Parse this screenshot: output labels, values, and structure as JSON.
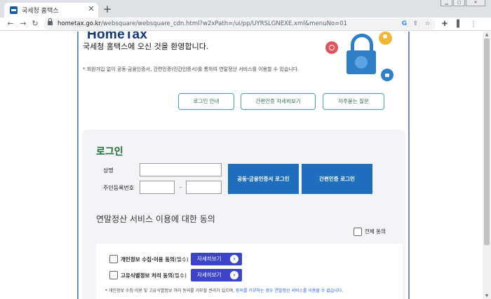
{
  "browser": {
    "tab_title": "국세청 홈택스",
    "tab_close": "✕",
    "new_tab": "+",
    "url_host": "hometax.go.kr",
    "url_path": "/websquare/websquare_cdn.html?w2xPath=/ui/pp/UYRSLGNEXE.xml&menuNo=01",
    "icons": {
      "back": "back-icon",
      "forward": "forward-icon",
      "reload": "reload-icon",
      "lock": "lock-icon",
      "google": "google-icon",
      "share": "share-icon",
      "star": "star-icon",
      "extensions": "puzzle-icon",
      "sidepanel": "sidepanel-icon",
      "menu": "menu-dots-icon"
    }
  },
  "header": {
    "logo": "HomeTax",
    "welcome": "국세청 홈택스에 오신 것을 환영합니다.",
    "notice": "* 회원가입 없이 공동·금융인증서, 간편인증(민간인증서)를 통하여 연말정산 서비스를 이용할 수 있습니다."
  },
  "links": {
    "login_guide": "로그인 안내",
    "simple_auth_detail": "간편인증 자세히보기",
    "faq": "자주묻는 질문"
  },
  "login": {
    "title": "로그인",
    "name_label": "성명",
    "rrn_label": "주민등록번호",
    "rrn_separator": "-",
    "cert_login_button": "공동·금융인증서 로그인",
    "simple_login_button": "간편인증 로그인"
  },
  "consent": {
    "title": "연말정산 서비스 이용에 대한 동의",
    "agree_all": "전체 동의",
    "items": [
      {
        "label": "개인정보 수집·이용 동의",
        "required": "(필수)",
        "button": "자세히보기"
      },
      {
        "label": "고유식별정보 처리 동의",
        "required": "(필수)",
        "button": "자세히보기"
      }
    ],
    "footnote_prefix": "* 개인정보 수집·이용 및 고유식별정보 처리 동의를 거부할 권리가 있으며, ",
    "footnote_highlight": "동의를 거부하는 경우 연말정산 서비스를 이용할 수 없습니다."
  },
  "colors": {
    "accent_blue": "#1f6dbd",
    "detail_button": "#3c44c9",
    "login_title_green": "#1f6b32",
    "link_border_teal": "#3fa9a0",
    "logo_navy": "#12377a"
  }
}
